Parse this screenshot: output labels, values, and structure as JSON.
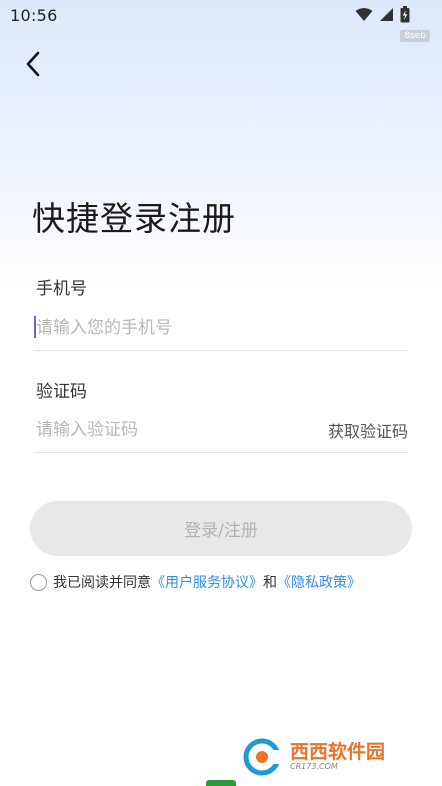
{
  "status_bar": {
    "time": "10:56"
  },
  "badge": "8seb",
  "title": "快捷登录注册",
  "phone": {
    "label": "手机号",
    "placeholder": "请输入您的手机号",
    "value": ""
  },
  "code": {
    "label": "验证码",
    "placeholder": "请输入验证码",
    "value": "",
    "get_code": "获取验证码"
  },
  "login_button": "登录/注册",
  "agreement": {
    "prefix": "我已阅读并同意",
    "terms": "《用户服务协议》",
    "and": "和",
    "privacy": "《隐私政策》",
    "checked": false
  },
  "watermark": {
    "brand": "西西软件园",
    "domain": "CR173.COM"
  },
  "colors": {
    "link": "#2f8df0",
    "button_bg": "#e8e8e8",
    "cursor": "#6d5fd6"
  }
}
